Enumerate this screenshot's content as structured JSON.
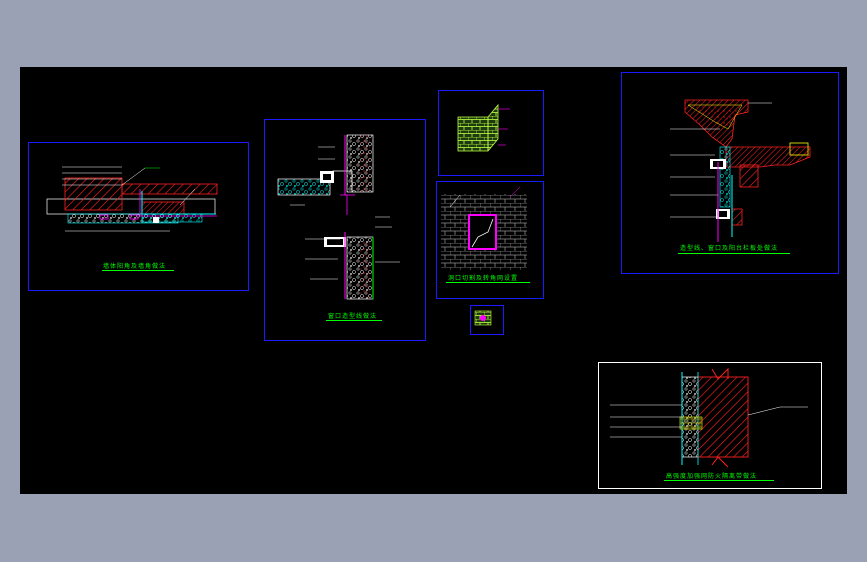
{
  "colors": {
    "background": "#000000",
    "frame_blue": "#1a1aff",
    "frame_white": "#ffffff",
    "caption_green": "#00ff00",
    "line_cyan": "#00ffff",
    "hatch_red": "#ff2020",
    "fill_magenta": "#ff00ff",
    "line_white": "#ffffff"
  },
  "details": [
    {
      "caption": "墙体阳角及墙角做法"
    },
    {
      "caption": "窗口造型线做法"
    },
    {
      "caption": ""
    },
    {
      "caption": "洞口切割及转角网设置"
    },
    {
      "caption": "造型线、窗口及阳台栏板处做法"
    },
    {
      "caption": "高强度加强网防火隔离带做法"
    }
  ]
}
